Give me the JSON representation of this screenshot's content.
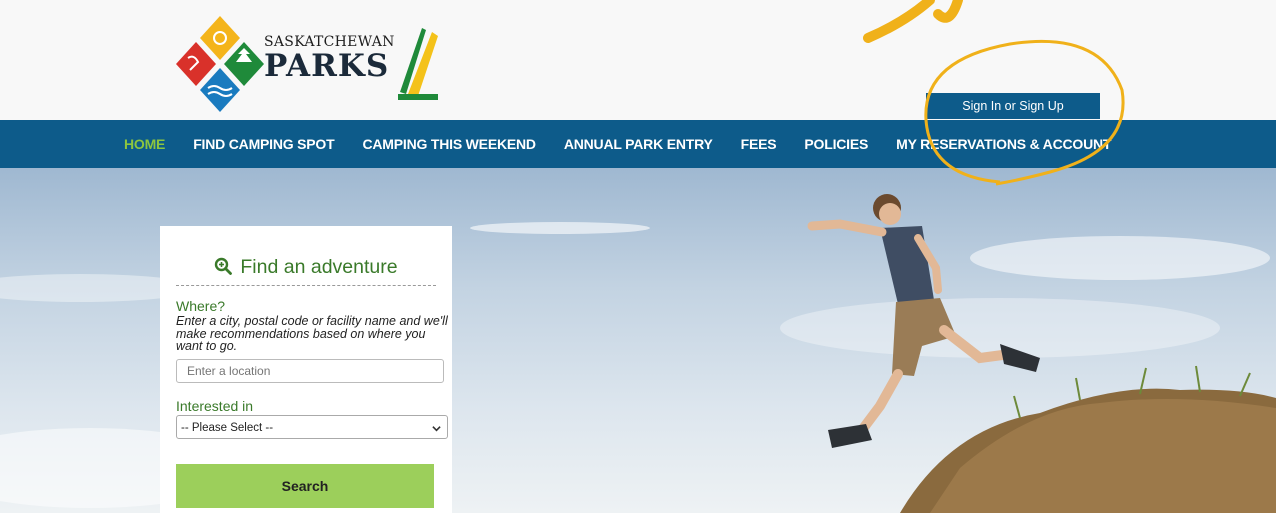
{
  "brand": {
    "line1": "SASKATCHEWAN",
    "line2": "PARKS",
    "logo_icon": "saskatchewan-parks-logo"
  },
  "header": {
    "signin_label": "Sign In or Sign Up"
  },
  "nav": {
    "items": [
      {
        "label": "HOME",
        "active": true
      },
      {
        "label": "FIND CAMPING SPOT"
      },
      {
        "label": "CAMPING THIS WEEKEND"
      },
      {
        "label": "ANNUAL PARK ENTRY"
      },
      {
        "label": "FEES"
      },
      {
        "label": "POLICIES"
      },
      {
        "label": "MY RESERVATIONS & ACCOUNT"
      }
    ]
  },
  "search": {
    "title": "Find an adventure",
    "title_icon": "search-icon",
    "where_label": "Where?",
    "where_hint": "Enter a city, postal code or facility name and we'll make recommendations based on where you want to go.",
    "location_placeholder": "Enter a location",
    "location_value": "",
    "interested_label": "Interested in",
    "interested_selected": "-- Please Select --",
    "search_button": "Search"
  },
  "colors": {
    "nav_bg": "#0d5b8a",
    "nav_active": "#8cc63f",
    "accent_green": "#3a7a2a",
    "button_green": "#9ccf5b",
    "annotation": "#f0b11a"
  }
}
